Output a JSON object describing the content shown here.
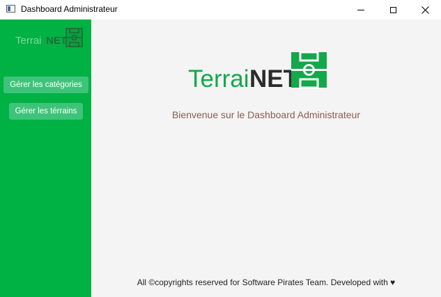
{
  "window": {
    "title": "Dashboard Administrateur"
  },
  "sidebar": {
    "logo": {
      "part1": "Terrai",
      "part2": "NET"
    },
    "items": [
      {
        "label": "Gérer les catégories"
      },
      {
        "label": "Gérer les térrains"
      }
    ]
  },
  "main": {
    "logo": {
      "part1": "Terrai",
      "part2": "NET"
    },
    "welcome": "Bienvenue sur le Dashboard Administrateur",
    "footer": "All ©copyrights reserved for Software Pirates Team. Developed with ♥"
  },
  "colors": {
    "brand_green": "#00b244",
    "button_green": "#3ec47a",
    "dark_text": "#2b2b2b",
    "welcome_text": "#8b5b52"
  },
  "icons": [
    "app-window-icon",
    "minimize-icon",
    "maximize-icon",
    "close-icon",
    "football-field-icon"
  ]
}
